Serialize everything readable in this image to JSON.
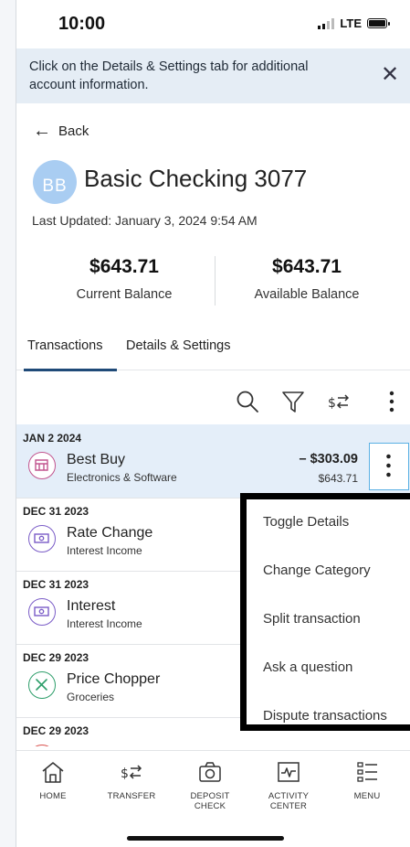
{
  "status_bar": {
    "time": "10:00",
    "network": "LTE"
  },
  "notice": {
    "text": "Click on the Details & Settings tab for additional account information.",
    "close_icon": "close-icon"
  },
  "back": {
    "label": "Back"
  },
  "account": {
    "initials": "BB",
    "title": "Basic Checking 3077",
    "last_updated": "Last Updated: January 3, 2024 9:54 AM"
  },
  "balances": {
    "current": {
      "amount": "$643.71",
      "label": "Current Balance"
    },
    "available": {
      "amount": "$643.71",
      "label": "Available Balance"
    }
  },
  "tabs": [
    {
      "label": "Transactions",
      "active": true
    },
    {
      "label": "Details & Settings",
      "active": false
    }
  ],
  "toolbar_icons": [
    "search-icon",
    "filter-icon",
    "transfer-icon",
    "more-vertical-icon"
  ],
  "transactions": [
    {
      "date": "JAN 2 2024",
      "name": "Best Buy",
      "category": "Electronics & Software",
      "amount": "– $303.09",
      "balance": "$643.71",
      "icon": "shopping-cart-icon",
      "icon_color": "#c2558f",
      "selected": true
    },
    {
      "date": "DEC 31 2023",
      "name": "Rate Change",
      "category": "Interest Income",
      "amount": "",
      "balance": "",
      "icon": "cash-icon",
      "icon_color": "#7a5cc7",
      "selected": false
    },
    {
      "date": "DEC 31 2023",
      "name": "Interest",
      "category": "Interest Income",
      "amount": "",
      "balance": "",
      "icon": "cash-icon",
      "icon_color": "#7a5cc7",
      "selected": false
    },
    {
      "date": "DEC 29 2023",
      "name": "Price Chopper",
      "category": "Groceries",
      "amount": "",
      "balance": "",
      "icon": "utensils-icon",
      "icon_color": "#2e9e6a",
      "selected": false
    },
    {
      "date": "DEC 29 2023",
      "name": "",
      "category": "",
      "amount": "",
      "balance": "",
      "icon": "",
      "icon_color": "#d9534f",
      "selected": false
    }
  ],
  "context_menu": {
    "items": [
      "Toggle Details",
      "Change Category",
      "Split transaction",
      "Ask a question",
      "Dispute transactions"
    ]
  },
  "bottom_nav": [
    {
      "label": "HOME",
      "icon": "home-icon"
    },
    {
      "label": "TRANSFER",
      "icon": "transfer-icon"
    },
    {
      "label": "DEPOSIT\nCHECK",
      "icon": "camera-icon"
    },
    {
      "label": "ACTIVITY\nCENTER",
      "icon": "activity-icon"
    },
    {
      "label": "MENU",
      "icon": "menu-icon"
    }
  ],
  "colors": {
    "accent": "#1f4a78",
    "notice_bg": "#e5edf5",
    "selected_row": "#e4eef9",
    "avatar": "#a9cdf2",
    "focus_border": "#5ab0e4"
  }
}
